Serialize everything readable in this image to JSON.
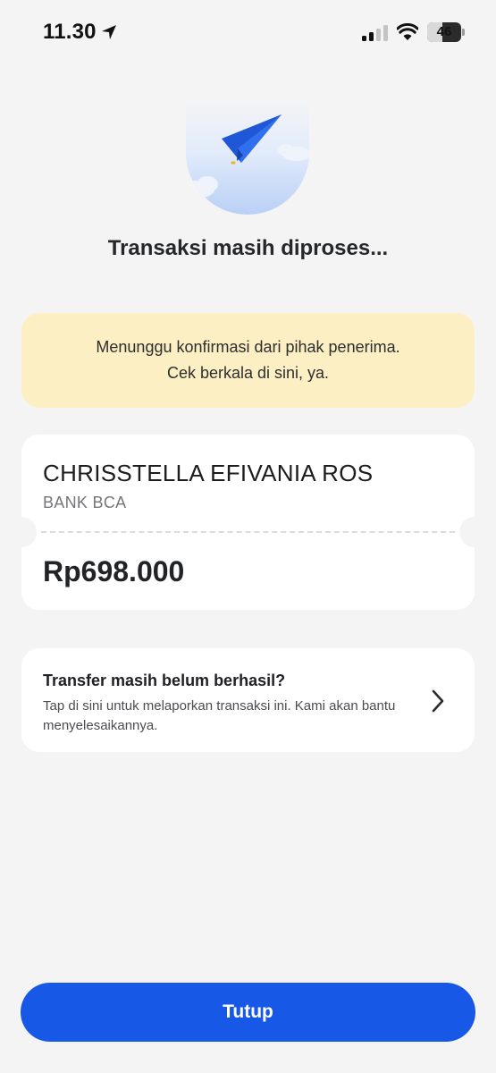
{
  "status_bar": {
    "time": "11.30",
    "battery_level": "46",
    "battery_fraction": 0.46,
    "icons": [
      "location-arrow-icon",
      "cellular-signal-icon",
      "wifi-icon",
      "battery-icon"
    ]
  },
  "hero": {
    "icon": "paper-plane-icon"
  },
  "title": "Transaksi masih diproses...",
  "info_banner": {
    "line1": "Menunggu konfirmasi dari pihak penerima.",
    "line2": "Cek berkala di sini, ya."
  },
  "recipient": {
    "name": "CHRISSTELLA EFIVANIA ROS",
    "bank": "BANK BCA",
    "amount": "Rp698.000"
  },
  "report": {
    "title": "Transfer masih belum berhasil?",
    "description": "Tap di sini untuk melaporkan transaksi ini. Kami akan bantu menyelesaikannya.",
    "icon": "chevron-right-icon"
  },
  "close_button": {
    "label": "Tutup"
  },
  "colors": {
    "background": "#f4f4f5",
    "primary": "#1758e6",
    "banner": "#fbefc3",
    "card": "#ffffff"
  }
}
